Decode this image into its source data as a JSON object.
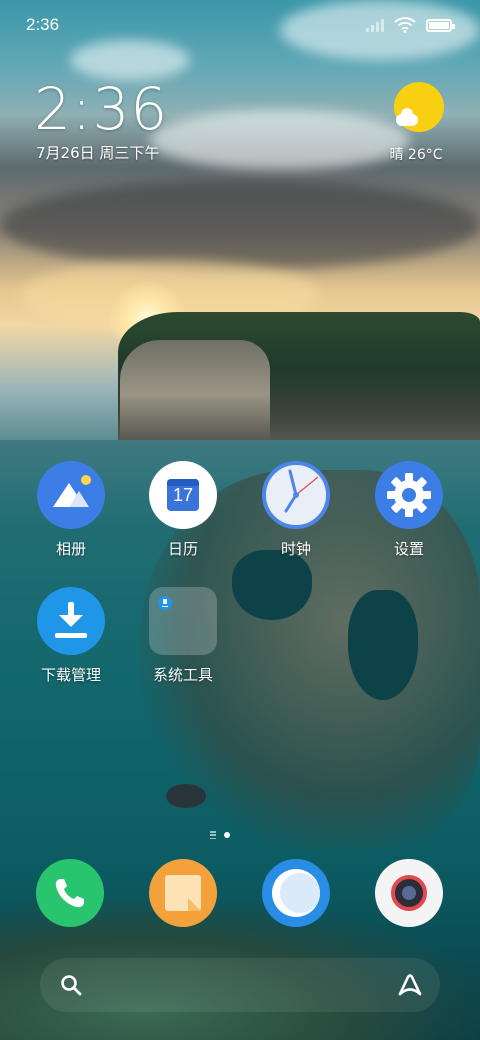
{
  "status_bar": {
    "time": "2:36"
  },
  "clock_widget": {
    "time": "2:36",
    "date": "7月26日 周三下午"
  },
  "weather_widget": {
    "text": "晴 26°C"
  },
  "apps": [
    {
      "label": "相册",
      "icon": "gallery-icon"
    },
    {
      "label": "日历",
      "icon": "calendar-icon",
      "day": "17"
    },
    {
      "label": "时钟",
      "icon": "clock-icon"
    },
    {
      "label": "设置",
      "icon": "gear-icon"
    },
    {
      "label": "下载管理",
      "icon": "download-icon"
    },
    {
      "label": "系统工具",
      "icon": "folder-icon"
    }
  ],
  "dock": [
    {
      "icon": "phone-icon"
    },
    {
      "icon": "notes-icon"
    },
    {
      "icon": "browser-icon"
    },
    {
      "icon": "camera-icon"
    }
  ],
  "search_bar": {
    "left_icon": "search-icon",
    "right_icon": "assistant-icon"
  },
  "colors": {
    "weather_sun": "#f9cf12",
    "app_blue": "#3d7de6",
    "phone_green": "#28c46e",
    "notes_orange": "#f3a13a"
  }
}
